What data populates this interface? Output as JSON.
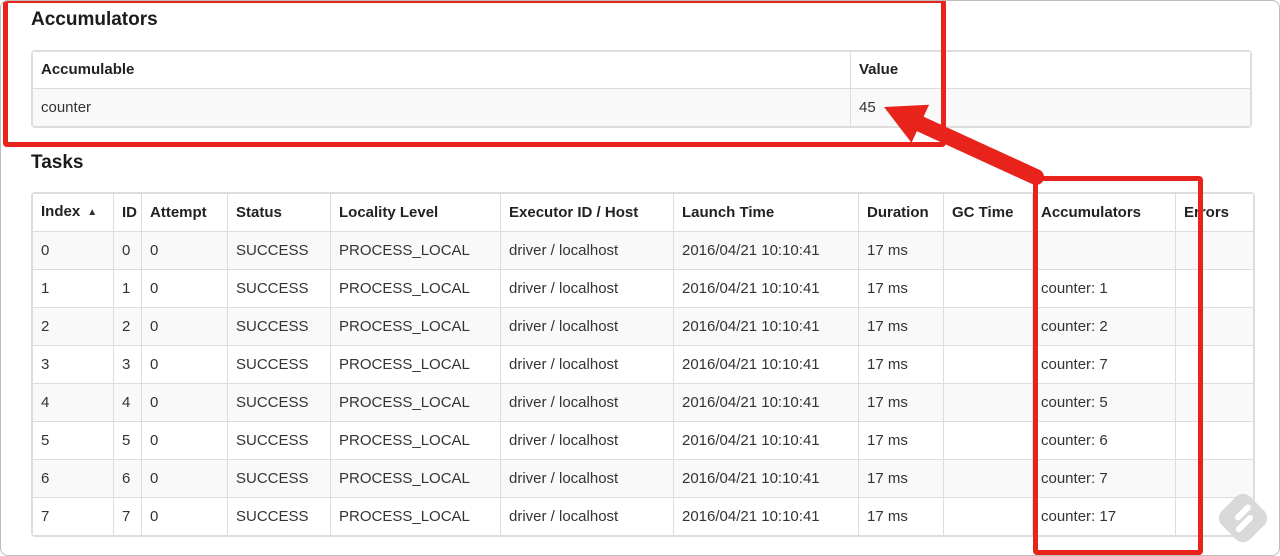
{
  "accumulators_section": {
    "title": "Accumulators",
    "table": {
      "headers": [
        "Accumulable",
        "Value"
      ],
      "rows": [
        [
          "counter",
          "45"
        ]
      ]
    }
  },
  "tasks_section": {
    "title": "Tasks",
    "table": {
      "headers": [
        "Index",
        "ID",
        "Attempt",
        "Status",
        "Locality Level",
        "Executor ID / Host",
        "Launch Time",
        "Duration",
        "GC Time",
        "Accumulators",
        "Errors"
      ],
      "sorted_column": "Index",
      "sort_indicator": "▲",
      "rows": [
        [
          "0",
          "0",
          "0",
          "SUCCESS",
          "PROCESS_LOCAL",
          "driver / localhost",
          "2016/04/21 10:10:41",
          "17 ms",
          "",
          "",
          ""
        ],
        [
          "1",
          "1",
          "0",
          "SUCCESS",
          "PROCESS_LOCAL",
          "driver / localhost",
          "2016/04/21 10:10:41",
          "17 ms",
          "",
          "counter: 1",
          ""
        ],
        [
          "2",
          "2",
          "0",
          "SUCCESS",
          "PROCESS_LOCAL",
          "driver / localhost",
          "2016/04/21 10:10:41",
          "17 ms",
          "",
          "counter: 2",
          ""
        ],
        [
          "3",
          "3",
          "0",
          "SUCCESS",
          "PROCESS_LOCAL",
          "driver / localhost",
          "2016/04/21 10:10:41",
          "17 ms",
          "",
          "counter: 7",
          ""
        ],
        [
          "4",
          "4",
          "0",
          "SUCCESS",
          "PROCESS_LOCAL",
          "driver / localhost",
          "2016/04/21 10:10:41",
          "17 ms",
          "",
          "counter: 5",
          ""
        ],
        [
          "5",
          "5",
          "0",
          "SUCCESS",
          "PROCESS_LOCAL",
          "driver / localhost",
          "2016/04/21 10:10:41",
          "17 ms",
          "",
          "counter: 6",
          ""
        ],
        [
          "6",
          "6",
          "0",
          "SUCCESS",
          "PROCESS_LOCAL",
          "driver / localhost",
          "2016/04/21 10:10:41",
          "17 ms",
          "",
          "counter: 7",
          ""
        ],
        [
          "7",
          "7",
          "0",
          "SUCCESS",
          "PROCESS_LOCAL",
          "driver / localhost",
          "2016/04/21 10:10:41",
          "17 ms",
          "",
          "counter: 17",
          ""
        ]
      ]
    }
  },
  "annotations": {
    "highlight_color": "#e8231c"
  }
}
